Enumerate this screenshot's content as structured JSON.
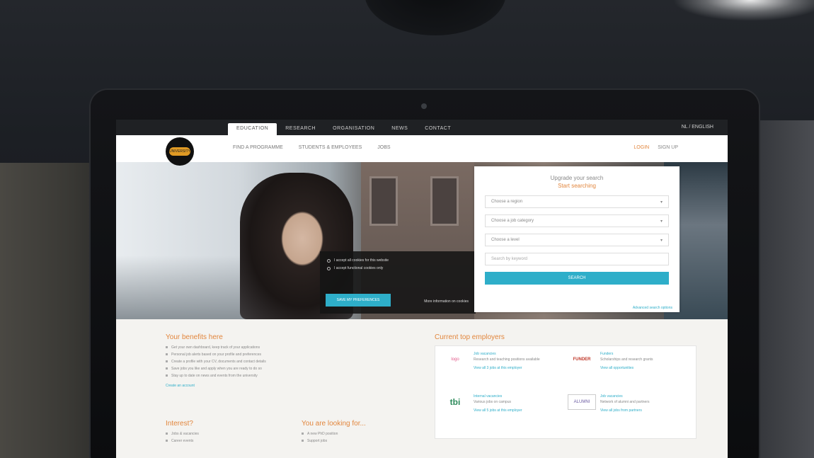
{
  "topnav": {
    "tabs": [
      "EDUCATION",
      "RESEARCH",
      "ORGANISATION",
      "NEWS",
      "CONTACT"
    ],
    "active": 0,
    "language": "NL / ENGLISH"
  },
  "header": {
    "logo_text": "UNIVERSITY",
    "subnav": [
      "FIND A PROGRAMME",
      "STUDENTS & EMPLOYEES",
      "JOBS"
    ],
    "auth": [
      "LOGIN",
      "SIGN UP"
    ]
  },
  "cookie": {
    "option1": "I accept all cookies for this website",
    "option2": "I accept functional cookies only",
    "accept_button": "SAVE MY PREFERENCES",
    "more_link": "More information on cookies"
  },
  "search": {
    "title": "Upgrade your search",
    "subtitle": "Start searching",
    "select1": "Choose a region",
    "select2": "Choose a job category",
    "select3": "Choose a level",
    "keyword_placeholder": "Search by keyword",
    "submit": "SEARCH",
    "advanced": "Advanced search options"
  },
  "about": {
    "heading": "Your benefits here",
    "items": [
      "Get your own dashboard, keep track of your applications",
      "Personal job alerts based on your profile and preferences",
      "Create a profile with your CV, documents and contact details",
      "Save jobs you like and apply when you are ready to do so",
      "Stay up to date on news and events from the university"
    ],
    "more": "Create an account"
  },
  "interests": {
    "heading": "Interest?",
    "items": [
      "Jobs & vacancies",
      "Career events"
    ]
  },
  "looking": {
    "heading": "You are looking for...",
    "items": [
      "A new PhD position",
      "Support jobs"
    ]
  },
  "jobs": {
    "heading": "Current top employers",
    "items": [
      {
        "logo": "logo",
        "logo_color": "#e25a8a",
        "title": "Job vacancies",
        "desc": "Research and teaching positions available",
        "link": "View all 3 jobs at this employer"
      },
      {
        "logo": "FUNDER",
        "logo_color": "#c0392b",
        "title": "Funders",
        "desc": "Scholarships and research grants",
        "link": "View all opportunities"
      },
      {
        "logo": "tbi",
        "logo_color": "#2c8a5a",
        "title": "Internal vacancies",
        "desc": "Various jobs on campus",
        "link": "View all 5 jobs at this employer"
      },
      {
        "logo": "ALUMNI",
        "logo_color": "#6a5aa0",
        "title": "Job vacancies",
        "desc": "Network of alumni and partners",
        "link": "View all jobs from partners"
      }
    ]
  }
}
